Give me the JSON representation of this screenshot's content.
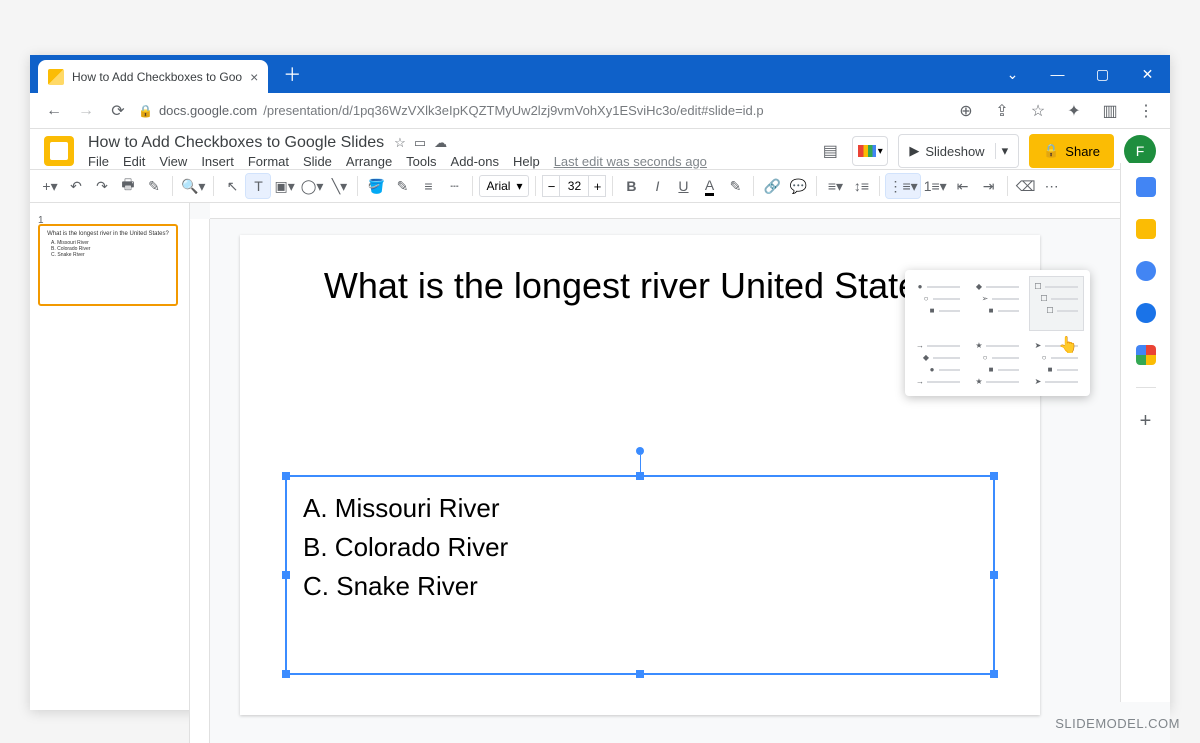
{
  "browser": {
    "tab_title": "How to Add Checkboxes to Goo",
    "url_host": "docs.google.com",
    "url_path": "/presentation/d/1pq36WzVXlk3eIpKQZTMyUw2lzj9vmVohXy1ESviHc3o/edit#slide=id.p"
  },
  "doc": {
    "title": "How to Add Checkboxes to Google Slides",
    "menu": {
      "file": "File",
      "edit": "Edit",
      "view": "View",
      "insert": "Insert",
      "format": "Format",
      "slide": "Slide",
      "arrange": "Arrange",
      "tools": "Tools",
      "addons": "Add-ons",
      "help": "Help"
    },
    "last_edit": "Last edit was seconds ago",
    "slideshow": "Slideshow",
    "share": "Share",
    "avatar": "F"
  },
  "toolbar": {
    "font": "Arial",
    "size": "32"
  },
  "thumb": {
    "num": "1",
    "title": "What is the longest river in the United States?",
    "a": "A. Missouri River",
    "b": "B. Colorado River",
    "c": "C. Snake River"
  },
  "slide": {
    "title_line": "What is the longest river United States?",
    "opt_a": "A. Missouri River",
    "opt_b": "B. Colorado River",
    "opt_c": "C. Snake River"
  },
  "watermark": "SLIDEMODEL.COM"
}
